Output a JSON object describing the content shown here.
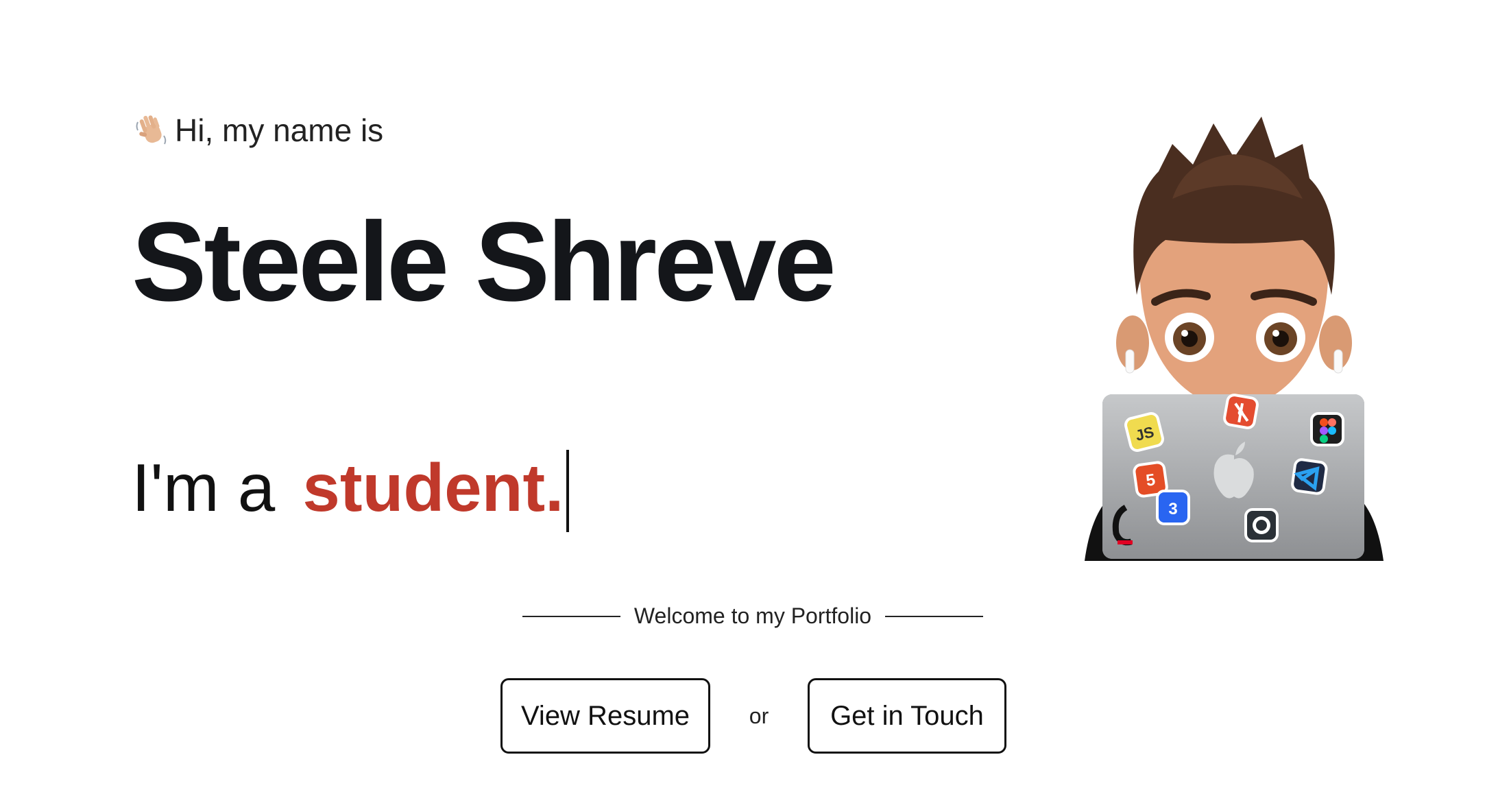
{
  "hero": {
    "greeting": "Hi, my name is",
    "name": "Steele Shreve",
    "role_prefix": "I'm a",
    "role_word": "student."
  },
  "welcome": {
    "text": "Welcome to my Portfolio"
  },
  "actions": {
    "resume_label": "View Resume",
    "or_label": "or",
    "touch_label": "Get in Touch"
  },
  "avatar": {
    "stickers": {
      "js": "JS"
    }
  },
  "colors": {
    "accent": "#c0392b",
    "text": "#14161a",
    "background": "#ffffff"
  },
  "icons": [
    "waving-hand-icon",
    "js-sticker-icon",
    "git-sticker-icon",
    "figma-sticker-icon",
    "apple-logo-icon",
    "html5-sticker-icon",
    "css3-sticker-icon",
    "vscode-sticker-icon",
    "github-sticker-icon",
    "cincinnati-c-sticker-icon"
  ]
}
